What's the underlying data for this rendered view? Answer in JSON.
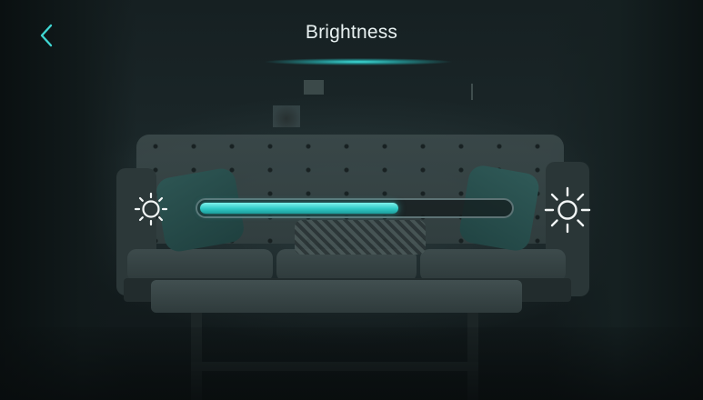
{
  "header": {
    "title": "Brightness",
    "back_icon": "chevron-left-icon"
  },
  "brightness_slider": {
    "level": 0.64,
    "min_icon": "sun-small-icon",
    "max_icon": "sun-large-icon"
  },
  "colors": {
    "accent": "#3fe0dc",
    "text": "#e8f1f1",
    "track_border": "#5d7375"
  }
}
